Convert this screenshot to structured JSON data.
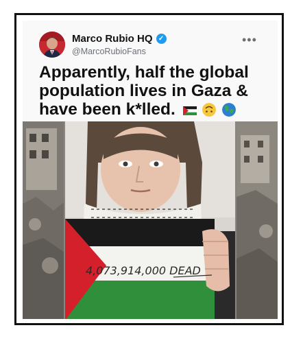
{
  "tweet": {
    "display_name": "Marco Rubio HQ",
    "handle": "@MarcoRubioFans",
    "more_label": "•••",
    "text_line1": "Apparently, half the global",
    "text_line2": "population lives in Gaza &",
    "text_line3": "have been k*lled.",
    "emojis": [
      "palestine-flag",
      "upside-down-face",
      "globe"
    ]
  },
  "image": {
    "sign_text": "4,073,914,000 DEAD"
  },
  "colors": {
    "verified": "#1d9bf0",
    "flag_red": "#d3202a",
    "flag_green": "#2f8f3b",
    "flag_black": "#1a1a1a"
  }
}
